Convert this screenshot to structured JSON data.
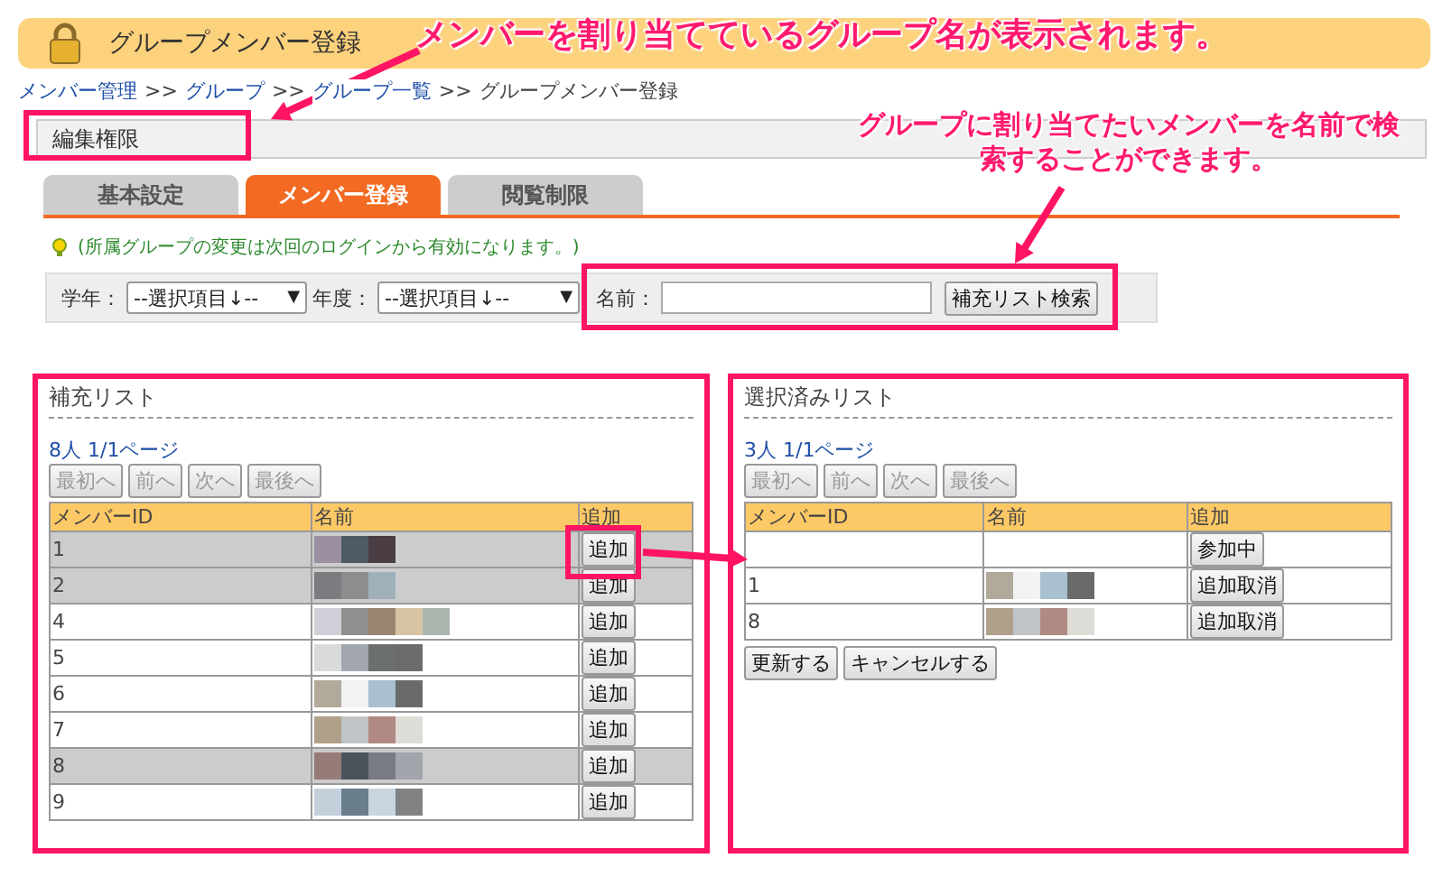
{
  "header": {
    "title": "グループメンバー登録"
  },
  "breadcrumb": {
    "separator": ">>",
    "items": [
      {
        "label": "メンバー管理",
        "link": true
      },
      {
        "label": "グループ",
        "link": true
      },
      {
        "label": "グループ一覧",
        "link": true
      },
      {
        "label": "グループメンバー登録",
        "link": false
      }
    ]
  },
  "group_name": "編集権限",
  "tabs": [
    {
      "label": "基本設定",
      "selected": false
    },
    {
      "label": "メンバー登録",
      "selected": true
    },
    {
      "label": "閲覧制限",
      "selected": false
    }
  ],
  "note": "(所属グループの変更は次回のログインから有効になります。)",
  "filter": {
    "grade_label": "学年：",
    "grade_value": "--選択項目↓--",
    "year_label": "年度：",
    "year_value": "--選択項目↓--",
    "caret": "▼",
    "name_label": "名前：",
    "search_button": "補充リスト検索"
  },
  "candidates": {
    "title": "補充リスト",
    "count": "8人 1/1ページ",
    "pager": [
      {
        "label": "最初へ",
        "disabled": true
      },
      {
        "label": "前へ",
        "disabled": true
      },
      {
        "label": "次へ",
        "disabled": true
      },
      {
        "label": "最後へ",
        "disabled": true
      }
    ],
    "columns": [
      "メンバーID",
      "名前",
      "追加"
    ],
    "rows": [
      {
        "id": "1",
        "highlighted": true,
        "action": "追加"
      },
      {
        "id": "2",
        "highlighted": true,
        "action": "追加"
      },
      {
        "id": "4",
        "highlighted": false,
        "action": "追加"
      },
      {
        "id": "5",
        "highlighted": false,
        "action": "追加"
      },
      {
        "id": "6",
        "highlighted": false,
        "action": "追加"
      },
      {
        "id": "7",
        "highlighted": false,
        "action": "追加"
      },
      {
        "id": "8",
        "highlighted": true,
        "action": "追加"
      },
      {
        "id": "9",
        "highlighted": false,
        "action": "追加"
      }
    ]
  },
  "selected_list": {
    "title": "選択済みリスト",
    "count": "3人 1/1ページ",
    "pager": [
      {
        "label": "最初へ",
        "disabled": true
      },
      {
        "label": "前へ",
        "disabled": true
      },
      {
        "label": "次へ",
        "disabled": true
      },
      {
        "label": "最後へ",
        "disabled": true
      }
    ],
    "columns": [
      "メンバーID",
      "名前",
      "追加"
    ],
    "rows": [
      {
        "action": "参加中"
      },
      {
        "id": "1",
        "action": "追加取消"
      },
      {
        "id": "8",
        "action": "追加取消"
      }
    ],
    "buttons": [
      "更新する",
      "キャンセルする"
    ]
  },
  "callouts": [
    "メンバーを割り当てているグループ名が表示されます。",
    "グループに割り当てたいメンバーを名前で検索することができます。"
  ]
}
